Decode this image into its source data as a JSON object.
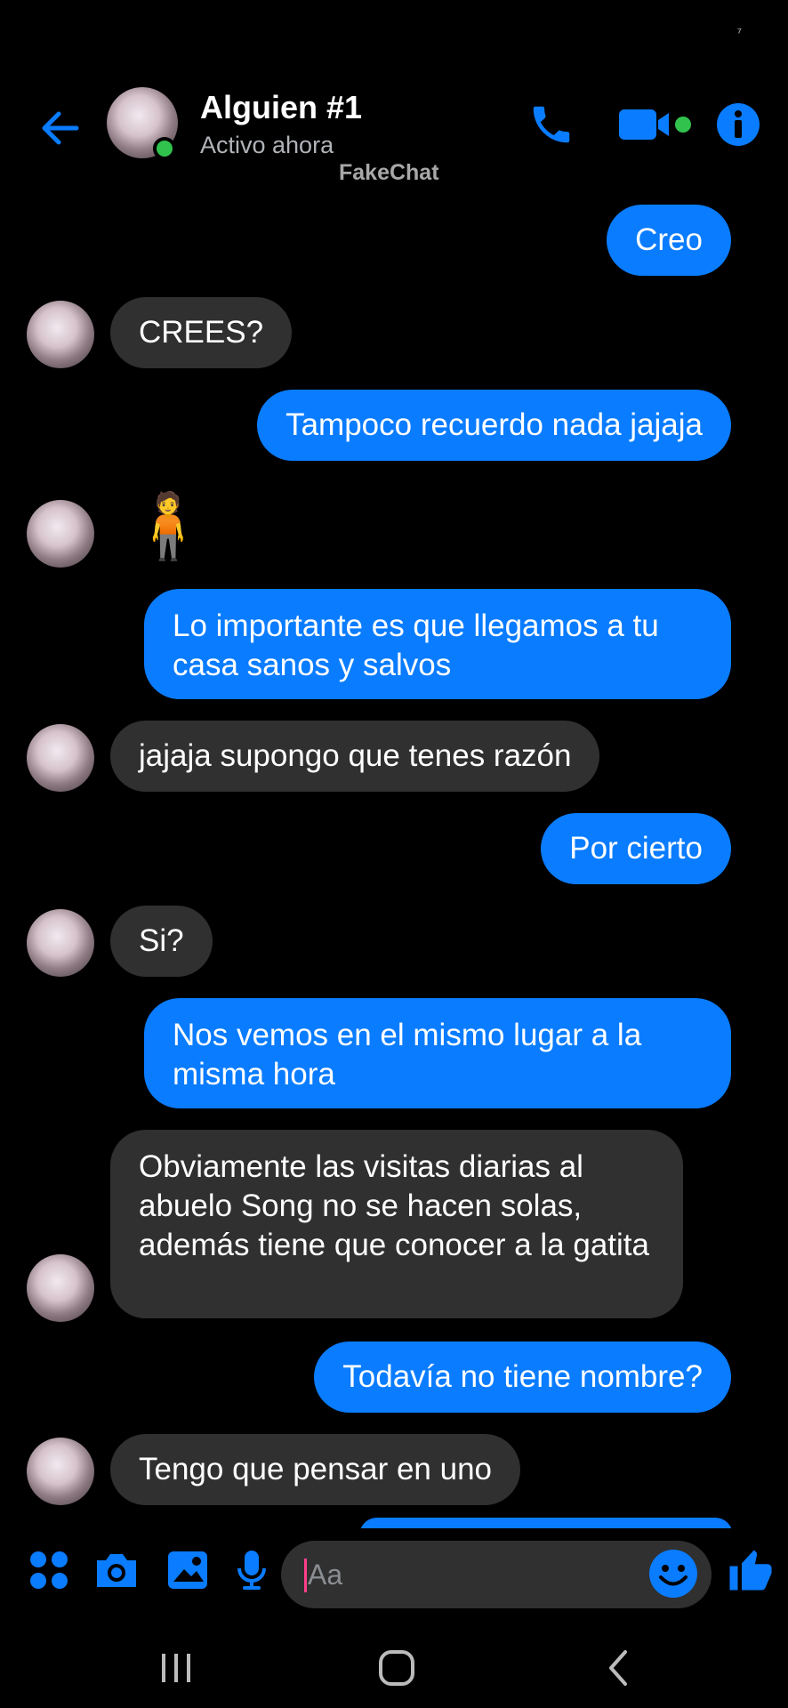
{
  "status_bar": {
    "glyph": "⁷"
  },
  "header": {
    "contact_name": "Alguien #1",
    "contact_status": "Activo ahora",
    "watermark": "FakeChat",
    "icons": [
      "back-arrow-icon",
      "phone-icon",
      "video-camera-icon",
      "info-icon"
    ]
  },
  "colors": {
    "accent": "#0a7cff",
    "incoming_bubble": "#303030",
    "online": "#31c24d",
    "background": "#000000"
  },
  "messages": [
    {
      "direction": "out",
      "text": "Creo"
    },
    {
      "direction": "in",
      "text": "CREES?"
    },
    {
      "direction": "out",
      "text": "Tampoco recuerdo nada jajaja"
    },
    {
      "direction": "in",
      "text": "🧍"
    },
    {
      "direction": "out",
      "text": "Lo importante es que llegamos a tu casa sanos y salvos"
    },
    {
      "direction": "in",
      "text": "jajaja supongo que tenes razón"
    },
    {
      "direction": "out",
      "text": "Por cierto"
    },
    {
      "direction": "in",
      "text": "Si?"
    },
    {
      "direction": "out",
      "text": "Nos vemos en el mismo lugar a la misma hora"
    },
    {
      "direction": "in",
      "text": "Obviamente las visitas diarias al abuelo Song no se hacen solas, además tiene que conocer a la gatita"
    },
    {
      "direction": "out",
      "text": "Todavía no tiene nombre?"
    },
    {
      "direction": "in",
      "text": "Tengo que pensar en uno"
    }
  ],
  "composer": {
    "placeholder": "Aa",
    "icons": [
      "apps-icon",
      "camera-icon",
      "image-icon",
      "microphone-icon",
      "emoji-icon",
      "thumbs-up-icon"
    ]
  },
  "navbar": {
    "icons": [
      "recent-apps-icon",
      "home-icon",
      "back-icon"
    ]
  }
}
